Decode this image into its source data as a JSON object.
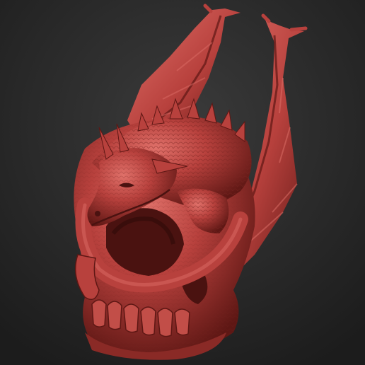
{
  "scene": {
    "background_top": "#3b3b3b",
    "background_bottom": "#1c1c1c",
    "model_color": "#b8413d",
    "model_highlight": "#e0716a",
    "model_shadow": "#5e1714"
  }
}
